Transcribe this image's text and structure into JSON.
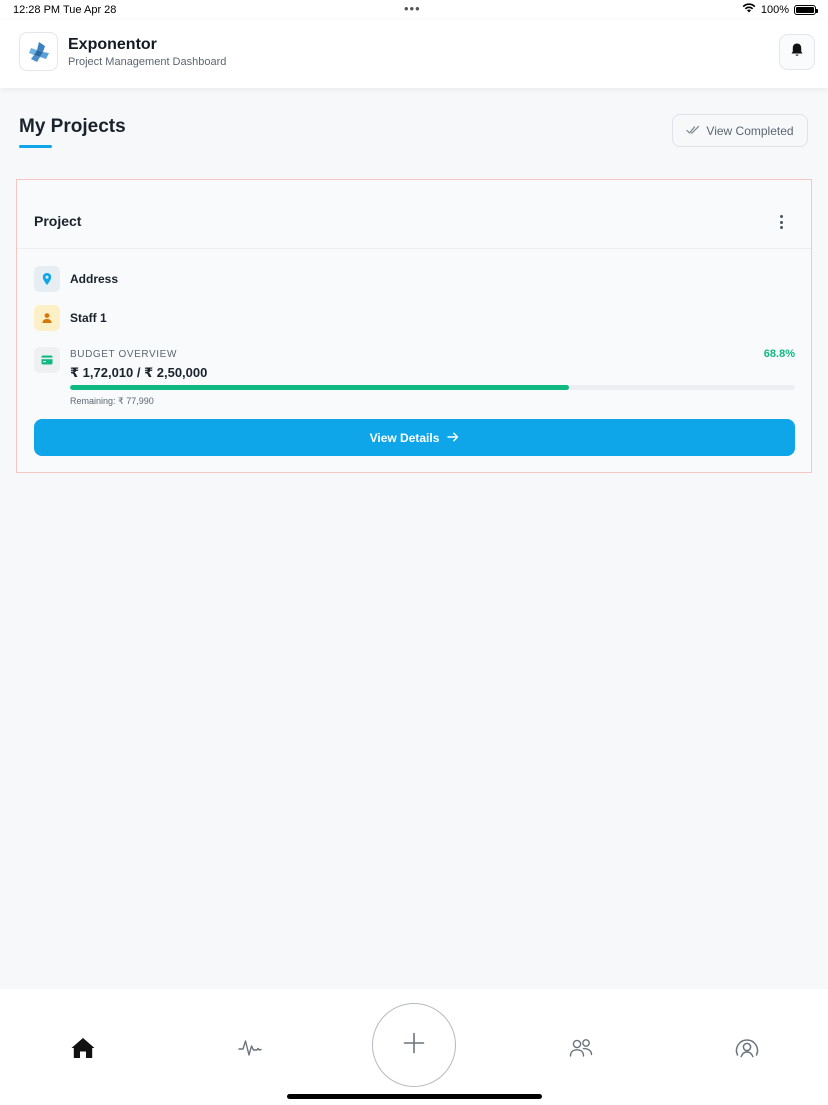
{
  "status_bar": {
    "time": "12:28 PM",
    "date": "Tue Apr 28",
    "battery": "100%"
  },
  "header": {
    "app_name": "Exponentor",
    "subtitle": "Project Management Dashboard",
    "logo_icon": "exponentor-logo",
    "bell_icon": "bell-icon"
  },
  "page": {
    "title": "My Projects",
    "view_completed_label": "View Completed"
  },
  "project": {
    "name": "Project",
    "address": "Address",
    "staff": "Staff 1",
    "budget": {
      "label": "BUDGET OVERVIEW",
      "amount": "₹ 1,72,010 / ₹ 2,50,000",
      "percent_text": "68.8%",
      "progress_fraction": 0.688,
      "remaining": "Remaining: ₹ 77,990"
    },
    "cta_label": "View Details"
  },
  "bottom_nav": {
    "items": [
      "home-icon",
      "activity-icon",
      "add-icon",
      "team-icon",
      "profile-icon"
    ],
    "active": "home-icon"
  },
  "colors": {
    "accent": "#0ea5e9",
    "success": "#10b981",
    "card_border": "#f6c6c0"
  }
}
